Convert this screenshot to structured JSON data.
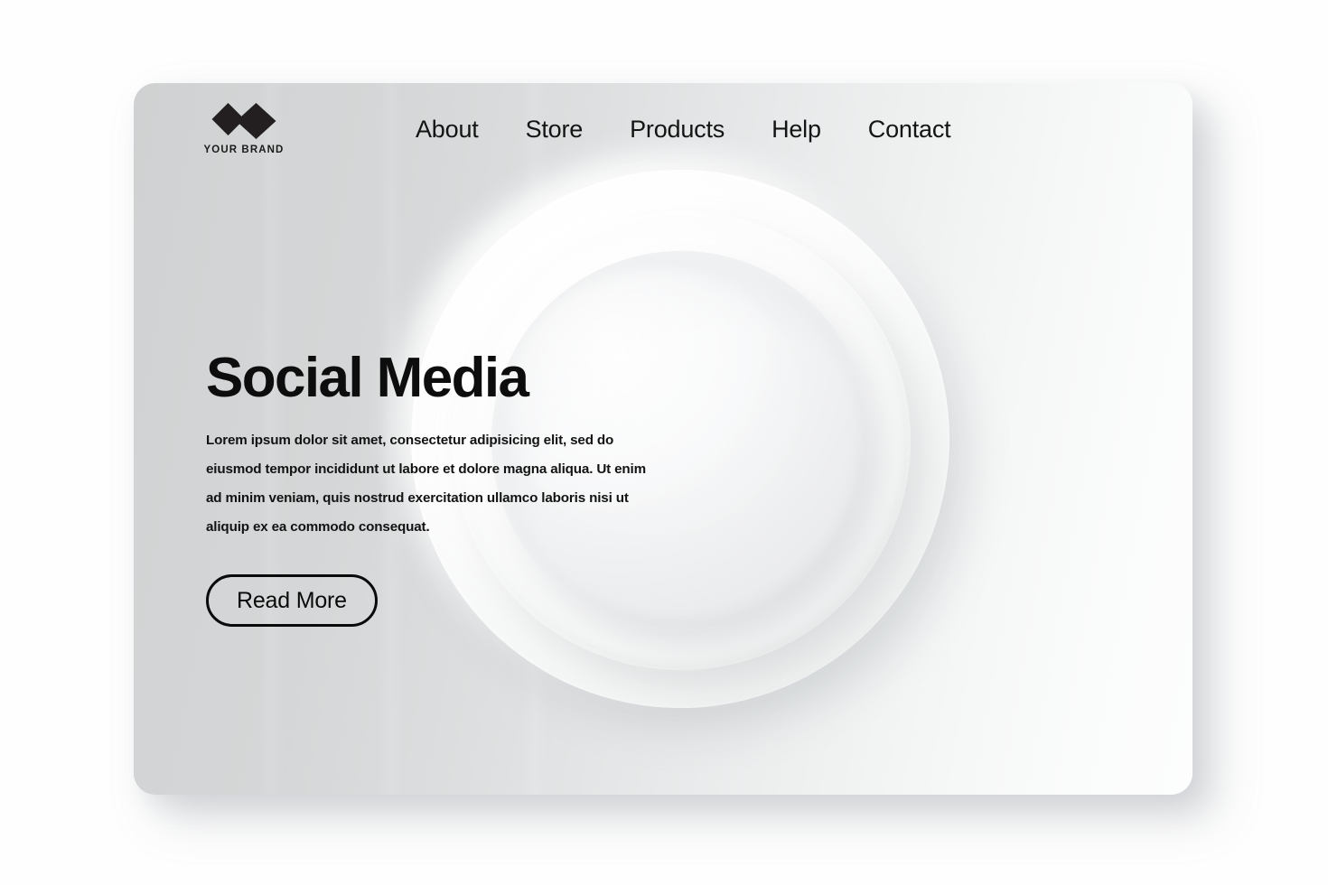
{
  "page": {
    "background_color": "#fefefe",
    "card_gradient_from": "#cfd1d2",
    "card_gradient_to": "#fdfdfd"
  },
  "header": {
    "brand": {
      "name": "YOUR BRAND",
      "logo_icon": "double-diamond-logo-icon",
      "logo_color": "#231f20"
    },
    "nav": [
      {
        "label": "About"
      },
      {
        "label": "Store"
      },
      {
        "label": "Products"
      },
      {
        "label": "Help"
      },
      {
        "label": "Contact"
      }
    ]
  },
  "hero": {
    "title": "Social Media",
    "paragraph": "Lorem ipsum dolor sit amet, consectetur adipisicing elit, sed do eiusmod tempor incididunt ut labore et dolore magna aliqua. Ut enim ad minim veniam, quis nostrud exercitation ullamco laboris nisi ut aliquip ex ea commodo consequat.",
    "cta_label": "Read More",
    "cta_border_color": "#0a0a0a",
    "title_color": "#0d0d0d"
  },
  "graphic": {
    "name": "neumorphic-concentric-circles",
    "ring_outer": "#fdfdfd",
    "ring_middle": "#fcfcfc",
    "circle_inner": "#f2f3f4"
  }
}
